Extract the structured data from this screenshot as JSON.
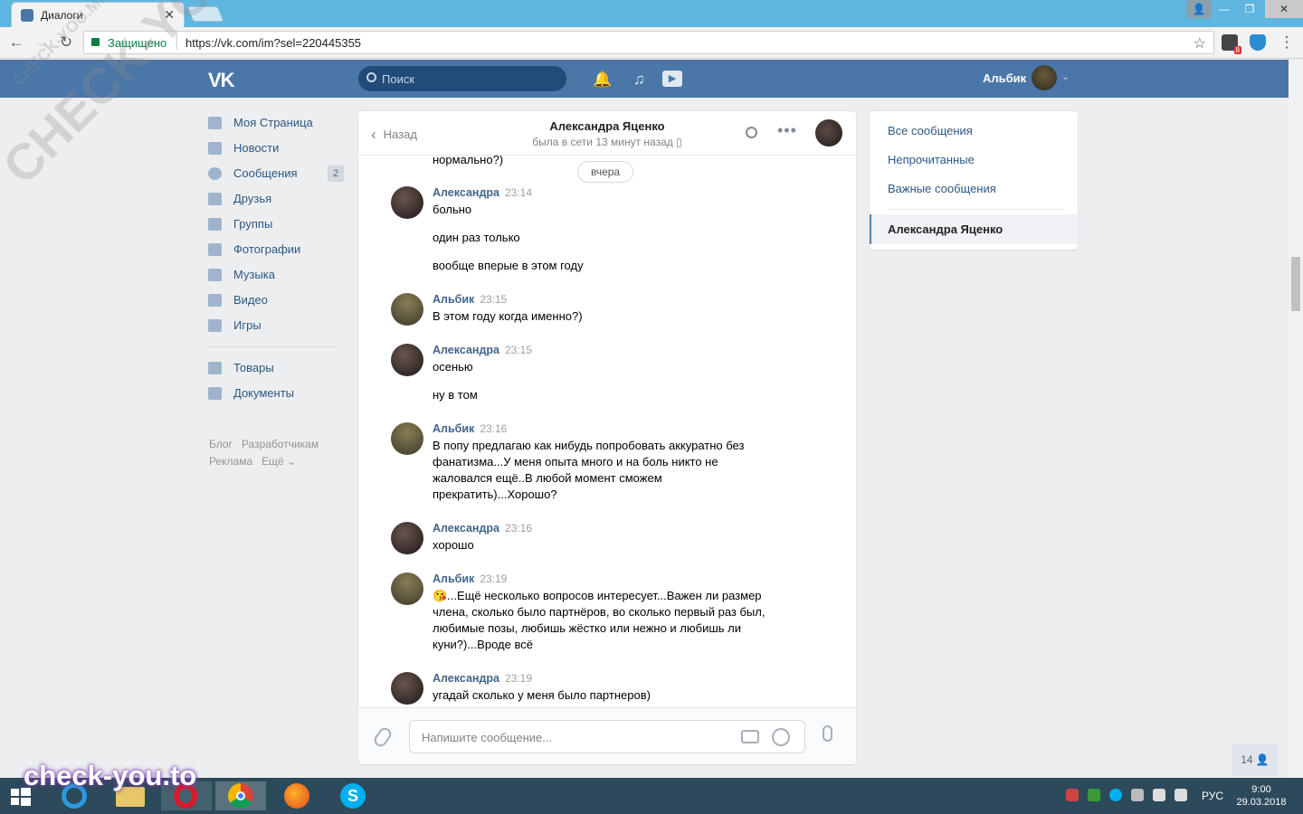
{
  "browser": {
    "tab_title": "Диалоги",
    "secure_label": "Защищено",
    "url": "https://vk.com/im?sel=220445355",
    "extension_badge": "8"
  },
  "header": {
    "search_placeholder": "Поиск",
    "user_name": "Альбик"
  },
  "menu": {
    "items": [
      {
        "label": "Моя Страница"
      },
      {
        "label": "Новости"
      },
      {
        "label": "Сообщения",
        "badge": "2"
      },
      {
        "label": "Друзья"
      },
      {
        "label": "Группы"
      },
      {
        "label": "Фотографии"
      },
      {
        "label": "Музыка"
      },
      {
        "label": "Видео"
      },
      {
        "label": "Игры"
      }
    ],
    "items2": [
      {
        "label": "Товары"
      },
      {
        "label": "Документы"
      }
    ],
    "footer": [
      "Блог",
      "Разработчикам",
      "Реклама",
      "Ещё ⌄"
    ]
  },
  "dialog": {
    "back_label": "Назад",
    "name": "Александра Яценко",
    "status": "была в сети 13 минут назад ▯",
    "prev_text": "нормально?)",
    "day_separator": "вчера",
    "messages": [
      {
        "author": "Александра",
        "time": "23:14",
        "lines": [
          "больно",
          "один раз только",
          "вообще вперые в этом году"
        ]
      },
      {
        "author": "Альбик",
        "time": "23:15",
        "lines": [
          "В этом году когда именно?)"
        ]
      },
      {
        "author": "Александра",
        "time": "23:15",
        "lines": [
          "осенью",
          "ну в том"
        ]
      },
      {
        "author": "Альбик",
        "time": "23:16",
        "lines": [
          "В попу предлагаю как нибудь попробовать аккуратно без",
          "фанатизма...У меня опыта много и на боль никто не",
          "жаловался ещё..В любой момент сможем",
          "прекратить)...Хорошо?"
        ]
      },
      {
        "author": "Александра",
        "time": "23:16",
        "lines": [
          "хорошо"
        ]
      },
      {
        "author": "Альбик",
        "time": "23:19",
        "lines": [
          "😘...Ещё несколько вопросов интересует...Важен ли размер",
          "члена, сколько было партнёров, во сколько первый раз был,",
          "любимые позы, любишь жёстко или нежно и любишь ли",
          "куни?)...Вроде всё"
        ]
      },
      {
        "author": "Александра",
        "time": "23:19",
        "lines": [
          "угадай сколько у меня было партнеров)"
        ]
      }
    ],
    "composer_placeholder": "Напишите сообщение..."
  },
  "right_panel": {
    "items": [
      "Все сообщения",
      "Непрочитанные",
      "Важные сообщения"
    ],
    "selected": "Александра Яценко"
  },
  "online_counter": "14 👤",
  "taskbar": {
    "lang": "РУС",
    "time": "9:00",
    "date": "29.03.2018"
  },
  "watermarks": {
    "diagonal": "CHECK-YOU.ME",
    "small": "CHECK-YOU.ME",
    "bottom": "check-you.to"
  }
}
